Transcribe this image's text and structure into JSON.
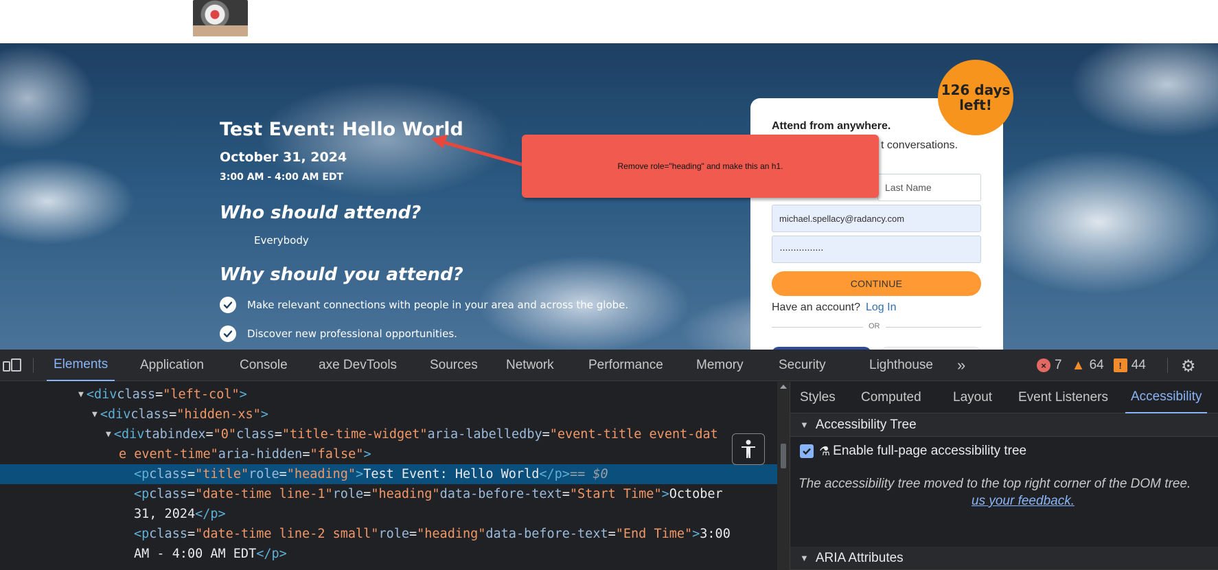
{
  "hero": {
    "event_title": "Test Event: Hello World",
    "event_date": "October 31, 2024",
    "event_time": "3:00 AM - 4:00 AM EDT",
    "who_heading": "Who should attend?",
    "who_value": "Everybody",
    "why_heading": "Why should you attend?",
    "benefits": [
      "Make relevant connections with people in your area and across the globe.",
      "Discover new professional opportunities."
    ]
  },
  "registration": {
    "heading": "Attend from anywhere.",
    "subheading_visible": "t conversations.",
    "last_name_placeholder": "Last Name",
    "email_value": "michael.spellacy@radancy.com",
    "password_value": "················",
    "continue_label": "CONTINUE",
    "have_account": "Have an account?",
    "login_link": "Log In",
    "or_label": "OR"
  },
  "badge": {
    "line1": "126 days",
    "line2": "left!"
  },
  "annotation": {
    "text": "Remove role=\"heading\" and make this an h1."
  },
  "devtools": {
    "tabs": [
      "Elements",
      "Application",
      "Console",
      "axe DevTools",
      "Sources",
      "Network",
      "Performance",
      "Memory",
      "Security",
      "Lighthouse"
    ],
    "active_tab": "Elements",
    "more_tabs": "»",
    "error_count": "7",
    "warning_count": "64",
    "issue_count": "44",
    "code": {
      "l1_tag_open": "<div",
      "l1_attr": " class",
      "l1_val": "\"left-col\"",
      "l1_close": ">",
      "l2_tag_open": "<div",
      "l2_attr": " class",
      "l2_val": "\"hidden-xs\"",
      "l2_close": ">",
      "l3_tag_open": "<div",
      "l3_attr1": " tabindex",
      "l3_val1": "\"0\"",
      "l3_attr2": " class",
      "l3_val2": "\"title-time-widget\"",
      "l3_attr3": " aria-labelledby",
      "l3_val3a": "\"event-title event-dat",
      "l3_val3b": "e event-time\"",
      "l3_attr4": " aria-hidden",
      "l3_val4": "\"false\"",
      "l3_close": ">",
      "l4_tag_open": "<p",
      "l4_attr1": " class",
      "l4_val1": "\"title\"",
      "l4_attr2": " role",
      "l4_val2": "\"heading\"",
      "l4_close": ">",
      "l4_text": "Test Event: Hello World",
      "l4_end": "</p>",
      "l4_eq": " == $0",
      "l5_tag_open": "<p",
      "l5_attr1": " class",
      "l5_val1": "\"date-time line-1\"",
      "l5_attr2": " role",
      "l5_val2": "\"heading\"",
      "l5_attr3": " data-before-text",
      "l5_val3": "\"Start Time\"",
      "l5_close": ">",
      "l5_text_a": "October",
      "l5_text_b": "31, 2024",
      "l5_end": "</p>",
      "l6_tag_open": "<p",
      "l6_attr1": " class",
      "l6_val1": "\"date-time line-2 small\"",
      "l6_attr2": " role",
      "l6_val2": "\"heading\"",
      "l6_attr3": " data-before-text",
      "l6_val3": "\"End Time\"",
      "l6_close": ">",
      "l6_text_a": "3:00",
      "l6_text_b": "AM - 4:00 AM EDT",
      "l6_end": "</p>"
    },
    "sidebar_tabs": [
      "Styles",
      "Computed",
      "Layout",
      "Event Listeners",
      "Accessibility"
    ],
    "sidebar_active": "Accessibility",
    "accessibility_tree_heading": "Accessibility Tree",
    "enable_full_page": "Enable full-page accessibility tree",
    "tree_moved_note": "The accessibility tree moved to the top right corner of the DOM tree.",
    "feedback_link": "us your feedback.",
    "aria_attributes_heading": "ARIA Attributes"
  }
}
